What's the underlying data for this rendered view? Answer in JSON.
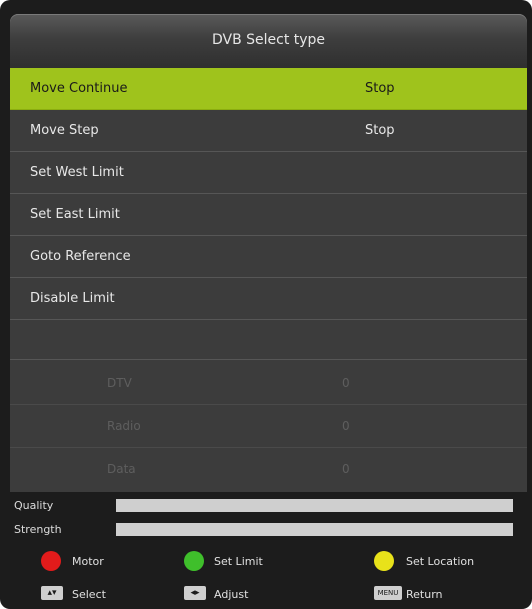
{
  "dialog": {
    "title": "DVB Select type"
  },
  "menu": {
    "items": [
      {
        "label": "Move Continue",
        "value": "Stop"
      },
      {
        "label": "Move Step",
        "value": "Stop"
      },
      {
        "label": "Set West Limit",
        "value": ""
      },
      {
        "label": "Set East Limit",
        "value": ""
      },
      {
        "label": "Goto Reference",
        "value": ""
      },
      {
        "label": "Disable Limit",
        "value": ""
      }
    ]
  },
  "channel_counts": [
    {
      "label": "DTV",
      "value": "0"
    },
    {
      "label": "Radio",
      "value": "0"
    },
    {
      "label": "Data",
      "value": "0"
    }
  ],
  "signal": {
    "quality_label": "Quality",
    "strength_label": "Strength"
  },
  "legend": {
    "red": "Motor",
    "green": "Set Limit",
    "yellow": "Set Location",
    "select": "Select",
    "adjust": "Adjust",
    "return": "Return",
    "menu_key": "MENU"
  },
  "colors": {
    "highlight": "#9fc31c",
    "red": "#e21b1b",
    "green": "#3fbf2b",
    "yellow": "#e8e21a"
  }
}
